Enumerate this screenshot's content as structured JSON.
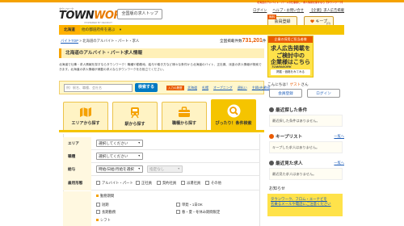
{
  "topnote": "北海道のアルバイト・パートの仕事探し・求人情報を探すなら【タウンワーク】",
  "logo": {
    "sub": "タウンワーク",
    "main_a": "TOWN",
    "main_b": "WORK",
    "tag": "POWERED BY RECRUIT"
  },
  "header": {
    "national_button": "全国版の求人トップ",
    "links": [
      "ログイン",
      "ヘルプ・お問い合せ",
      "ログイン",
      "【企業】求人広告掲載"
    ],
    "free_badge": "無料",
    "register_label": "会員登録",
    "keep_label": "キープ",
    "keep_count": "(0)"
  },
  "nav": {
    "tab_label": "北海道",
    "other_area": "他の都道府県を選ぶ",
    "caret": "▼"
  },
  "breadcrumb": {
    "top": "バイトTOP",
    "sep": ">",
    "current": "北海道のアルバイト・パート・求人"
  },
  "count": {
    "prefix": "全国掲載件数",
    "value": "731,201",
    "suffix": "件"
  },
  "page": {
    "title": "北海道のアルバイト・パート求人情報",
    "description": "北海道で仕事・求人情報を探すならタウンワーク！職種や勤務地、給与や働き方など様々な条件から北海道のバイト、正社員、派遣の求人情報が検索できます。北海道の求人情報が満載の求人ならタウンワークをお役立てください。"
  },
  "search": {
    "placeholder": "例）駅名、職種、会社名",
    "button": "検索する",
    "history_label": "入力の履歴",
    "history_links": [
      "北海道",
      "札幌",
      "オープニング",
      "週払い",
      "主婦(夫)歓迎"
    ]
  },
  "tabs": [
    {
      "label": "エリアから探す"
    },
    {
      "label": "駅から探す"
    },
    {
      "label": "職種から探す"
    },
    {
      "label": "ぴったり！条件検索"
    }
  ],
  "form": {
    "area": {
      "label": "エリア",
      "select": "選択してください"
    },
    "job": {
      "label": "職種",
      "select": "選択してください"
    },
    "pay": {
      "label": "給与",
      "select_a": "時給/日給/月給を選択",
      "select_b": "指定なし"
    },
    "employment": {
      "label": "雇用形態",
      "options": [
        "アルバイト・パート",
        "正社員",
        "契約社員",
        "派遣社員",
        "その他"
      ]
    },
    "period": {
      "heading": "勤務期間",
      "options": [
        "短期",
        "単発・1日OK",
        "長期勤務",
        "春・夏・冬休み期間限定"
      ]
    },
    "shift_heading": "シフト"
  },
  "sidebar": {
    "ad": {
      "head": "企業の採用ご担当者様",
      "body": "求人広告掲載を\nご検討中の\n企業様はこちら",
      "logo": "TOWNWORK",
      "button": "掲載・価格をみてみる"
    },
    "welcome_prefix": "こんにちは！",
    "welcome_name": "ゲスト",
    "welcome_suffix": "さん",
    "register_button": "会員登録",
    "login_button": "ログイン",
    "sections": [
      {
        "title": "最近探した条件",
        "body": "最近探した条件はありません。",
        "more": ""
      },
      {
        "title": "キープリスト",
        "body": "キープした求人はありません。",
        "more": "一覧へ"
      },
      {
        "title": "最近見た求人",
        "body": "最近見た求人はありません。",
        "more": "一覧へ"
      }
    ],
    "notice_title": "お知らせ",
    "notice_text": "タウンワーク、フロム・エーナビを\n名乗るメールや電話にご注意ください"
  },
  "colors": {
    "accent": "#f5c400",
    "orange": "#e95a00",
    "link": "#1a5bb8",
    "button_blue": "#0079c2"
  }
}
